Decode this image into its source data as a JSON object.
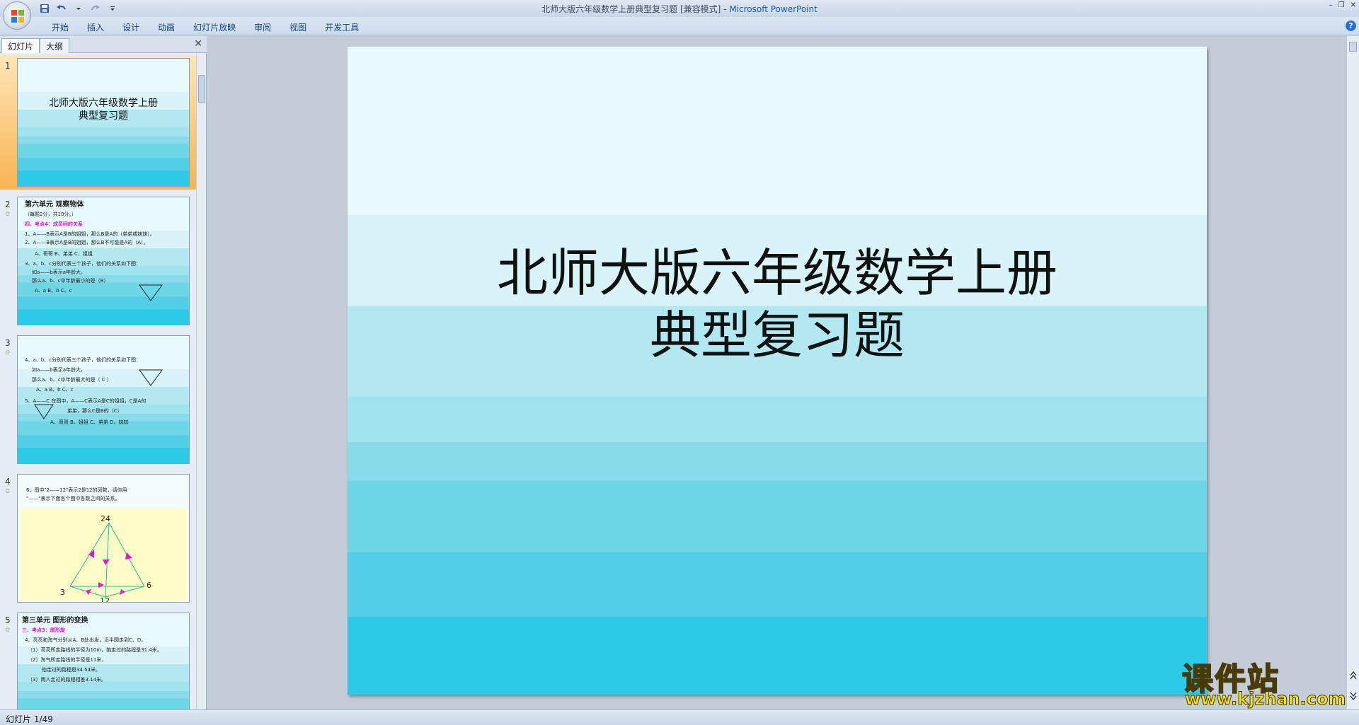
{
  "window": {
    "title_doc": "北师大版六年级数学上册典型复习题 [兼容模式]",
    "title_sep": " - ",
    "title_app": "Microsoft PowerPoint",
    "controls": [
      "–",
      "❐",
      "✕"
    ]
  },
  "ribbon": {
    "tabs": [
      "开始",
      "插入",
      "设计",
      "动画",
      "幻灯片放映",
      "审阅",
      "视图",
      "开发工具"
    ],
    "help": "?"
  },
  "pane": {
    "tab_slides": "幻灯片",
    "tab_outline": "大纲",
    "close": "✕"
  },
  "thumbnails": [
    {
      "number": "1",
      "title_line1": "北师大版六年级数学上册",
      "title_line2": "典型复习题"
    },
    {
      "number": "2",
      "lines": [
        "第六单元 观察物体",
        "（每题2分，共10分。）",
        "四、考点4：成员间的关系",
        "1、A——B表示A是B的姐姐，那么B是A的（",
        "弟弟或妹妹",
        "）。",
        "2、A——B表示A是B的姐姐，那么B不可能是A的（",
        "A",
        "）。",
        "A、哥哥    B、弟弟    C、姐姐",
        "3、a、b、c分别代表三个孩子，他们的关系如下图：",
        "如a——b表示a年龄大，",
        "那么a、b、c中年龄最小的是（",
        "B",
        "）",
        "A、a    B、b    C、c"
      ]
    },
    {
      "number": "3",
      "lines": [
        "4、a、b、c分别代表三个孩子，他们的关系如下图：",
        "如a——b表示a年龄大，",
        "那么a、b、c中年龄最大的是（  C  ）",
        "A、a    B、b    C、c",
        "5、A——C  在图中，A——C表示A是C的姐姐，C是A的",
        "弟弟，那么C是B的（",
        "C",
        "）",
        "A、哥哥  B、姐姐  C、弟弟  D、妹妹"
      ]
    },
    {
      "number": "4",
      "lines": [
        "6、图中\"2——12\"表示2是12的因数，请你用",
        "\"——\"表示下面各个图中各数之间的关系。"
      ],
      "nodes": [
        "24",
        "3",
        "6",
        "12"
      ]
    },
    {
      "number": "5",
      "lines": [
        "第三单元 图形的变换",
        "三、考点3：图形旋",
        "4、亮亮和淘气分别从A、B处出发，沿半圆走到C、D。",
        "（1）亮亮所走路线的半径为10m，她走过的路程是",
        "31.4",
        "米。",
        "（2）淘气所走路线的半径是",
        "11",
        "米，",
        "他走过的路程是",
        "34.54",
        "米。",
        "（3）两人走过的路程相差",
        "3.14",
        "米。"
      ]
    }
  ],
  "slide": {
    "title_line1": "北师大版六年级数学上册",
    "title_line2": "典型复习题"
  },
  "status": {
    "slide_info": "幻灯片 1/49"
  },
  "watermark": {
    "brand": "课件站",
    "url": "www.kjzhan.com"
  },
  "colors": {
    "stripe_1": "#e8fafc",
    "stripe_2": "#d8f4f8",
    "stripe_3": "#b2e8f1",
    "stripe_4": "#9fe3ee",
    "stripe_5": "#88dcea",
    "stripe_6": "#6fd6e8",
    "stripe_7": "#50cfe6",
    "stripe_8": "#2ccae6",
    "accent_pp": "#1c5bb3",
    "selected": "#f7b453"
  }
}
